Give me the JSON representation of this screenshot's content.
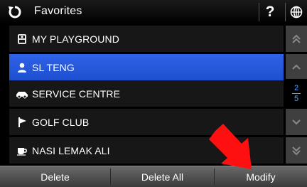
{
  "header": {
    "title": "Favorites",
    "help_label": "?",
    "back_icon": "refresh-back-icon",
    "globe_icon": "globe-icon"
  },
  "list": {
    "items": [
      {
        "label": "MY PLAYGROUND",
        "icon": "playground-icon",
        "selected": false
      },
      {
        "label": "SL TENG",
        "icon": "person-icon",
        "selected": true
      },
      {
        "label": "SERVICE CENTRE",
        "icon": "car-icon",
        "selected": false
      },
      {
        "label": "GOLF CLUB",
        "icon": "flag-icon",
        "selected": false
      },
      {
        "label": "NASI LEMAK ALI",
        "icon": "coffee-cup-icon",
        "selected": false
      }
    ]
  },
  "pagination": {
    "current": "2",
    "total": "5"
  },
  "bottom_bar": {
    "delete_label": "Delete",
    "delete_all_label": "Delete All",
    "modify_label": "Modify"
  },
  "colors": {
    "selection": "#2f63e8",
    "page_indicator": "#4aa3ff",
    "annotation_arrow": "#ff1010"
  }
}
